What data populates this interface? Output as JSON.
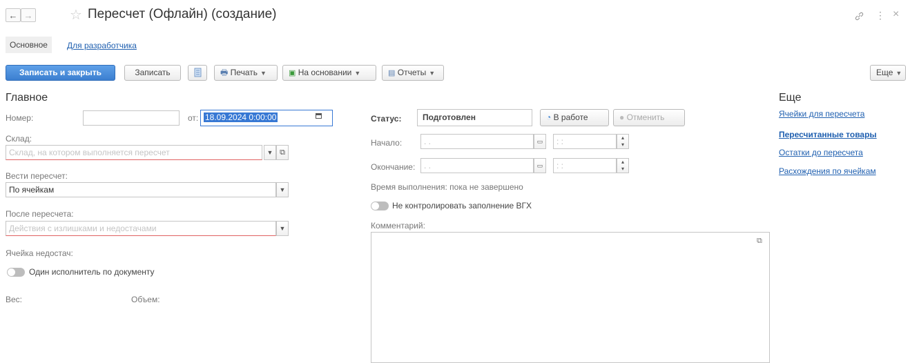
{
  "window": {
    "title": "Пересчет (Офлайн) (создание)",
    "back_icon": "←",
    "forward_icon": "→",
    "star_icon": "☆",
    "link_icon": "🔗",
    "menu_icon": "⋮",
    "close_icon": "×"
  },
  "tabs": [
    {
      "label": "Основное",
      "active": true
    },
    {
      "label": "Для разработчика",
      "active": false
    }
  ],
  "toolbar": {
    "save_close": "Записать и закрыть",
    "save": "Записать",
    "print": "Печать",
    "based_on": "На основании",
    "reports": "Отчеты",
    "more": "Еще"
  },
  "main": {
    "section_title": "Главное",
    "number_label": "Номер:",
    "number_value": "",
    "from_label": "от:",
    "date_value": "18.09.2024  0:00:00",
    "warehouse_label": "Склад:",
    "warehouse_placeholder": "Склад, на котором выполняется пересчет",
    "recount_label": "Вести пересчет:",
    "recount_value": "По ячейкам",
    "after_label": "После пересчета:",
    "after_placeholder": "Действия с излишками и недостачами",
    "shortage_cell_label": "Ячейка недостач:",
    "single_executor_label": "Один исполнитель по документу",
    "weight_label": "Вес:",
    "volume_label": "Объем:"
  },
  "status_panel": {
    "status_label": "Статус:",
    "status_value": "Подготовлен",
    "in_work_button": "В работе",
    "cancel_button": "Отменить",
    "start_label": "Начало:",
    "start_date": " . . ",
    "start_time": " : : ",
    "end_label": "Окончание:",
    "end_date": " . . ",
    "end_time": " : : ",
    "exec_time": "Время выполнения: пока не завершено",
    "vgh_label": "Не контролировать заполнение ВГХ",
    "comment_label": "Комментарий:"
  },
  "more_panel": {
    "title": "Еще",
    "links": [
      {
        "label": "Ячейки для пересчета",
        "bold": false
      },
      {
        "label": "Пересчитанные товары",
        "bold": true
      },
      {
        "label": "Остатки до пересчета",
        "bold": false
      },
      {
        "label": "Расхождения по ячейкам",
        "bold": false
      }
    ]
  },
  "colors": {
    "primary": "#3c7fd0",
    "link": "#2060b0",
    "required_underline": "#e06060",
    "selection": "#3778d4"
  }
}
